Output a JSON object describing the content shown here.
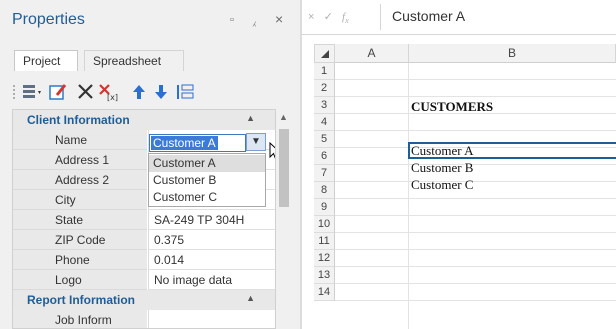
{
  "properties": {
    "title": "Properties",
    "tabs": [
      {
        "label": "Project",
        "active": true
      },
      {
        "label": "Spreadsheet",
        "active": false
      }
    ],
    "categories": [
      {
        "label": "Client Information",
        "rows": [
          {
            "label": "Name",
            "value": "Customer A"
          },
          {
            "label": "Address 1",
            "value": ""
          },
          {
            "label": "Address 2",
            "value": ""
          },
          {
            "label": "City",
            "value": ""
          },
          {
            "label": "State",
            "value": "SA-249 TP 304H"
          },
          {
            "label": "ZIP Code",
            "value": "0.375"
          },
          {
            "label": "Phone",
            "value": "0.014"
          },
          {
            "label": "Logo",
            "value": "No image data"
          }
        ]
      },
      {
        "label": "Report Information",
        "rows": [
          {
            "label": "Job Inform",
            "value": ""
          }
        ]
      }
    ],
    "dropdown": {
      "options": [
        "Customer A",
        "Customer B",
        "Customer C"
      ],
      "highlighted": "Customer A"
    }
  },
  "sheet": {
    "formula_value": "Customer A",
    "columns": [
      "A",
      "B"
    ],
    "rows": [
      "1",
      "2",
      "3",
      "4",
      "5",
      "6",
      "7",
      "8",
      "9",
      "10",
      "11",
      "12",
      "13",
      "14"
    ],
    "cells": {
      "b3": "CUSTOMERS",
      "b5": "Customer A",
      "b6": "Customer B",
      "b7": "Customer C"
    }
  },
  "colors": {
    "title": "#1f5d96",
    "selection": "#3a7ad9",
    "active_cell_border": "#1f5d96"
  }
}
